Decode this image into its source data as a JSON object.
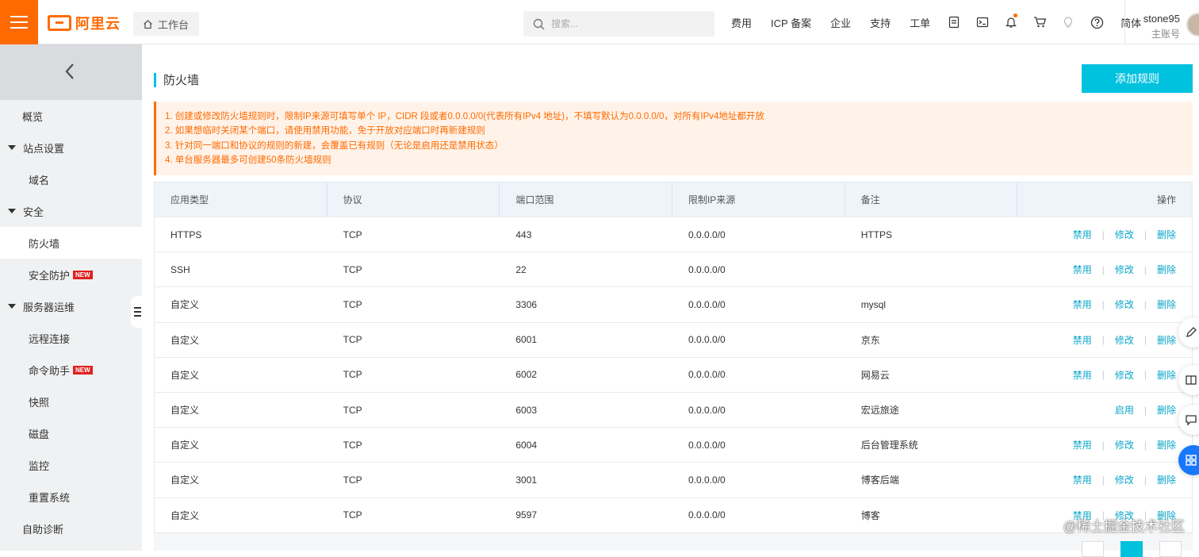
{
  "brand": {
    "name": "阿里云",
    "workbench": "工作台"
  },
  "search": {
    "placeholder": "搜索..."
  },
  "topnav": {
    "fees": "费用",
    "icp": "ICP 备案",
    "enterprise": "企业",
    "support": "支持",
    "ticket": "工单",
    "lang": "简体"
  },
  "account": {
    "username": "stone95",
    "role": "主账号"
  },
  "sidebar": {
    "overview": "概览",
    "site_settings": "站点设置",
    "domain": "域名",
    "security": "安全",
    "firewall": "防火墙",
    "protection": "安全防护",
    "ops": "服务器运维",
    "remote": "远程连接",
    "cmd": "命令助手",
    "snapshot": "快照",
    "disk": "磁盘",
    "monitor": "监控",
    "reset": "重置系统",
    "diagnose": "自助诊断",
    "new_badge": "NEW"
  },
  "page": {
    "title": "防火墙",
    "add_button": "添加规则"
  },
  "notice": [
    "1. 创建或修改防火墙规则时，限制IP来源可填写单个 IP，CIDR 段或者0.0.0.0/0(代表所有IPv4 地址)，不填写默认为0.0.0.0/0，对所有IPv4地址都开放",
    "2. 如果想临时关闭某个端口，请使用禁用功能，免于开放对应端口时再新建规则",
    "3. 针对同一端口和协议的规则的新建，会覆盖已有规则（无论是启用还是禁用状态）",
    "4. 单台服务器最多可创建50条防火墙规则"
  ],
  "table": {
    "headers": {
      "type": "应用类型",
      "protocol": "协议",
      "port": "端口范围",
      "source": "限制IP来源",
      "remark": "备注",
      "ops": "操作"
    },
    "actions": {
      "disable": "禁用",
      "enable": "启用",
      "edit": "修改",
      "delete": "删除"
    },
    "rows": [
      {
        "type": "HTTPS",
        "protocol": "TCP",
        "port": "443",
        "source": "0.0.0.0/0",
        "remark": "HTTPS",
        "state": "enabled"
      },
      {
        "type": "SSH",
        "protocol": "TCP",
        "port": "22",
        "source": "0.0.0.0/0",
        "remark": "",
        "state": "enabled"
      },
      {
        "type": "自定义",
        "protocol": "TCP",
        "port": "3306",
        "source": "0.0.0.0/0",
        "remark": "mysql",
        "state": "enabled"
      },
      {
        "type": "自定义",
        "protocol": "TCP",
        "port": "6001",
        "source": "0.0.0.0/0",
        "remark": "京东",
        "state": "enabled"
      },
      {
        "type": "自定义",
        "protocol": "TCP",
        "port": "6002",
        "source": "0.0.0.0/0",
        "remark": "网易云",
        "state": "enabled"
      },
      {
        "type": "自定义",
        "protocol": "TCP",
        "port": "6003",
        "source": "0.0.0.0/0",
        "remark": "宏远旅途",
        "state": "disabled"
      },
      {
        "type": "自定义",
        "protocol": "TCP",
        "port": "6004",
        "source": "0.0.0.0/0",
        "remark": "后台管理系统",
        "state": "enabled"
      },
      {
        "type": "自定义",
        "protocol": "TCP",
        "port": "3001",
        "source": "0.0.0.0/0",
        "remark": "博客后端",
        "state": "enabled"
      },
      {
        "type": "自定义",
        "protocol": "TCP",
        "port": "9597",
        "source": "0.0.0.0/0",
        "remark": "博客",
        "state": "enabled"
      }
    ]
  },
  "watermark": "@稀土掘金技术社区",
  "colors": {
    "brand": "#ff6a00",
    "accent": "#00c1de",
    "link": "#0aa6c9"
  }
}
